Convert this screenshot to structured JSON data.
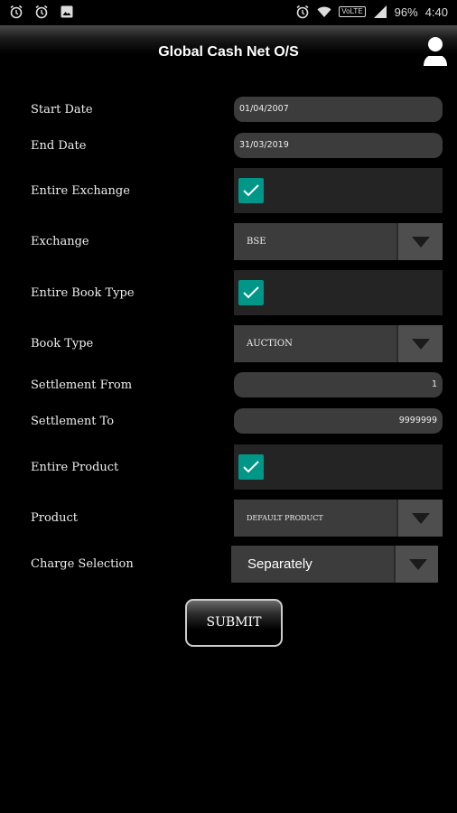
{
  "status_bar": {
    "battery": "96%",
    "time": "4:40",
    "network_badge": "VoLTE"
  },
  "header": {
    "title": "Global Cash Net O/S"
  },
  "form": {
    "start_date": {
      "label": "Start Date",
      "value": "01/04/2007"
    },
    "end_date": {
      "label": "End Date",
      "value": "31/03/2019"
    },
    "entire_exchange": {
      "label": "Entire Exchange",
      "checked": true
    },
    "exchange": {
      "label": "Exchange",
      "value": "BSE"
    },
    "entire_book_type": {
      "label": "Entire Book Type",
      "checked": true
    },
    "book_type": {
      "label": "Book Type",
      "value": "AUCTION"
    },
    "settlement_from": {
      "label": "Settlement From",
      "value": "1"
    },
    "settlement_to": {
      "label": "Settlement To",
      "value": "9999999"
    },
    "entire_product": {
      "label": "Entire Product",
      "checked": true
    },
    "product": {
      "label": "Product",
      "value": "DEFAULT PRODUCT"
    },
    "charge_selection": {
      "label": "Charge Selection",
      "value": "Separately"
    },
    "submit_label": "SUBMIT"
  },
  "colors": {
    "accent": "#009688",
    "background": "#000000",
    "field": "#3c3c3c"
  },
  "icons": [
    "alarm-icon",
    "alarm-icon",
    "image-icon",
    "alarm-icon",
    "wifi-icon",
    "signal-icon",
    "battery-icon",
    "user-icon",
    "check-icon",
    "dropdown-arrow-icon"
  ]
}
